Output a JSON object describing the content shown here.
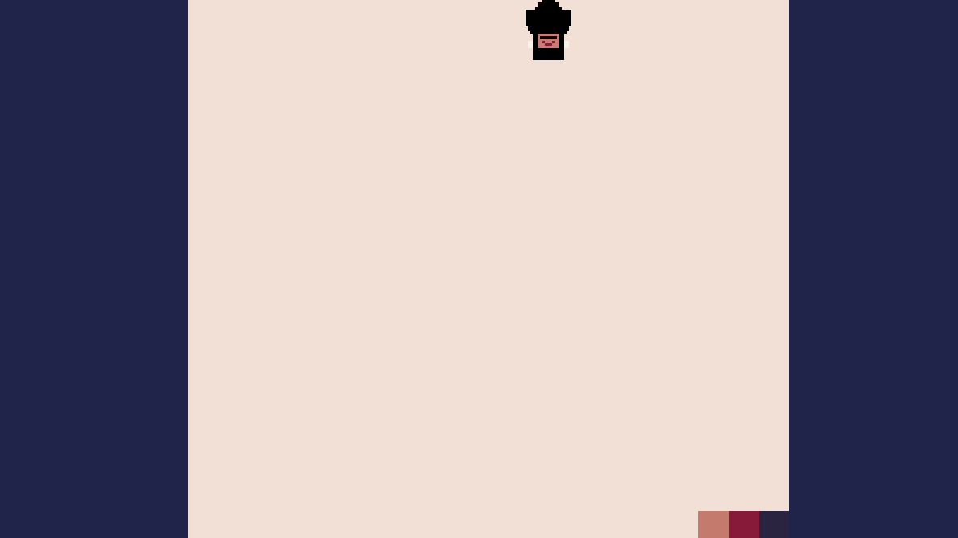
{
  "colors": {
    "backdrop": "#20234a",
    "canvas": "#f2e0d6",
    "sprite_dark": "#000000",
    "sprite_skin": "#c87a74",
    "sprite_accent": "#8a1c3a",
    "sprite_white": "#f8f0ea"
  },
  "player": {
    "icon": "robot-character-icon"
  },
  "palette": {
    "swatches": [
      {
        "name": "salmon",
        "color": "#c47a6c"
      },
      {
        "name": "crimson",
        "color": "#871a39"
      },
      {
        "name": "dark-purple",
        "color": "#2a2440"
      }
    ]
  }
}
